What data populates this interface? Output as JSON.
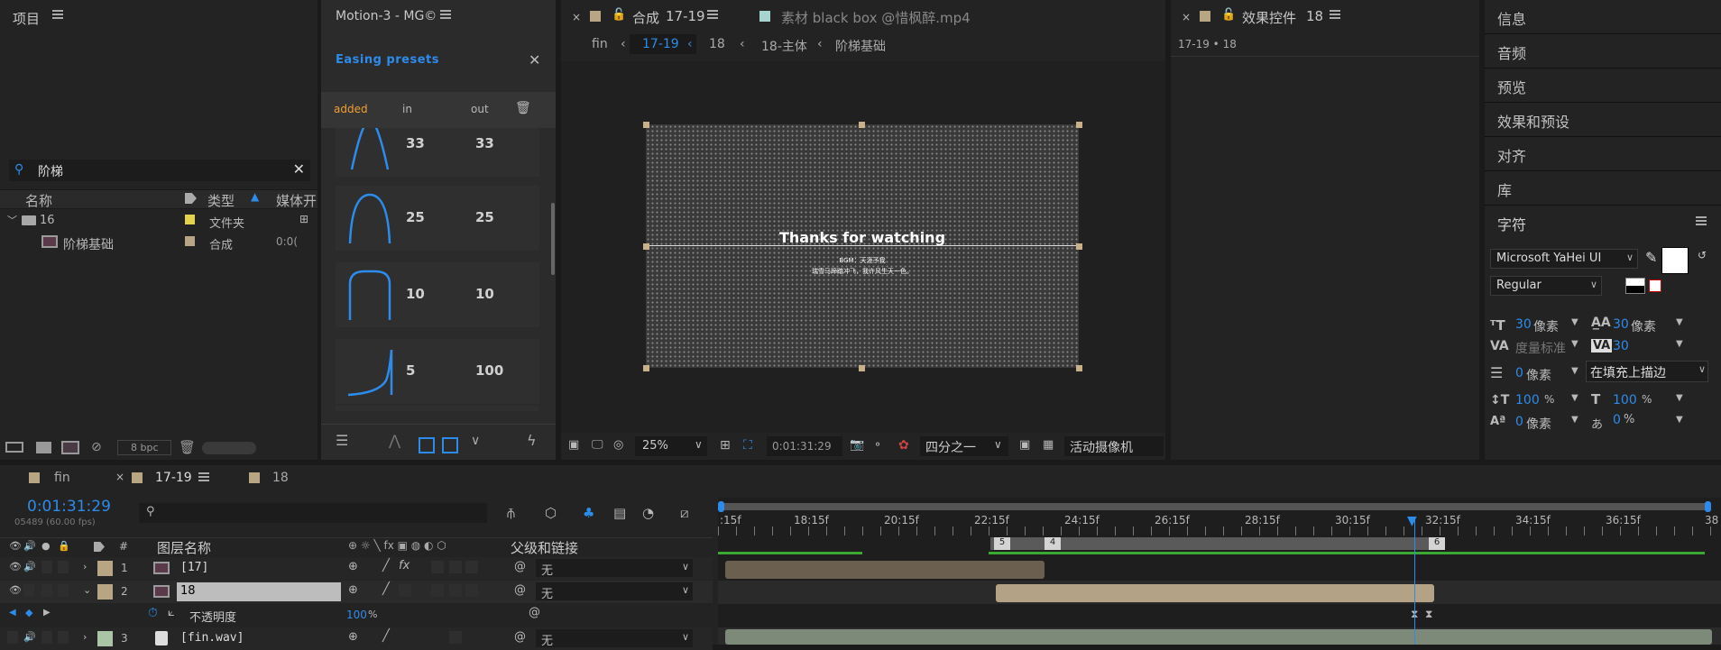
{
  "project": {
    "title": "项目",
    "search_value": "阶梯",
    "cols": [
      "名称",
      "类型",
      "媒体开"
    ],
    "rows": [
      {
        "name": "16",
        "type": "文件夹",
        "extra": ""
      },
      {
        "name": "阶梯基础",
        "type": "合成",
        "extra": "0:0("
      }
    ],
    "bpc": "8 bpc"
  },
  "motion": {
    "title": "Motion-3 - MG©",
    "presets_title": "Easing presets",
    "tabs": [
      "added",
      "in",
      "out"
    ],
    "cards": [
      {
        "in": "33",
        "out": "33"
      },
      {
        "in": "25",
        "out": "25"
      },
      {
        "in": "10",
        "out": "10"
      },
      {
        "in": "5",
        "out": "100"
      }
    ]
  },
  "comp": {
    "tab_label": "合成",
    "tab_comp": "17-19",
    "footage_tab": "素材 black box @惜枫醉.mp4",
    "breadcrumbs": [
      "fin",
      "17-19",
      "18",
      "18-主体",
      "阶梯基础"
    ],
    "preview_title": "Thanks for watching",
    "preview_line1": "BGM：天涯予我",
    "preview_line2": "瑞雪马蹄踏冲飞，我许风生天一色。",
    "zoom": "25%",
    "timecode": "0:01:31:29",
    "resolution": "四分之一",
    "camera": "活动摄像机"
  },
  "effects": {
    "title": "效果控件",
    "title_num": "18",
    "path": "17-19 • 18"
  },
  "right_panels": [
    "信息",
    "音频",
    "预览",
    "效果和预设",
    "对齐",
    "库"
  ],
  "character": {
    "title": "字符",
    "font": "Microsoft YaHei UI",
    "style": "Regular",
    "size": "30",
    "size_unit": "像素",
    "leading": "30",
    "leading_unit": "像素",
    "kerning": "度量标准",
    "tracking": "30",
    "stroke_width": "0",
    "stroke_unit": "像素",
    "stroke_mode": "在填充上描边",
    "vscale": "100",
    "hscale": "100",
    "pct": "%",
    "baseline": "0",
    "baseline_unit": "像素",
    "tsume": "0",
    "tsume_unit": "%"
  },
  "timeline": {
    "tabs": [
      "fin",
      "17-19",
      "18"
    ],
    "timecode": "0:01:31:29",
    "frames": "05489 (60.00 fps)",
    "ruler": [
      ":15f",
      "18:15f",
      "20:15f",
      "22:15f",
      "24:15f",
      "26:15f",
      "28:15f",
      "30:15f",
      "32:15f",
      "34:15f",
      "36:15f",
      "38"
    ],
    "markers": [
      "5",
      "4",
      "6"
    ],
    "headers": {
      "num": "#",
      "name": "图层名称",
      "parent": "父级和链接"
    },
    "layers": [
      {
        "num": "1",
        "name": "[17]",
        "parent": "无"
      },
      {
        "num": "2",
        "name": "18",
        "parent": "无"
      },
      {
        "num": "",
        "name": "不透明度",
        "value": "100",
        "unit": "%"
      },
      {
        "num": "3",
        "name": "[fin.wav]",
        "parent": "无"
      }
    ]
  },
  "colors": {
    "accent": "#2d8ceb",
    "orange": "#f0a030",
    "tan": "#b8a584",
    "panel": "#232323"
  }
}
